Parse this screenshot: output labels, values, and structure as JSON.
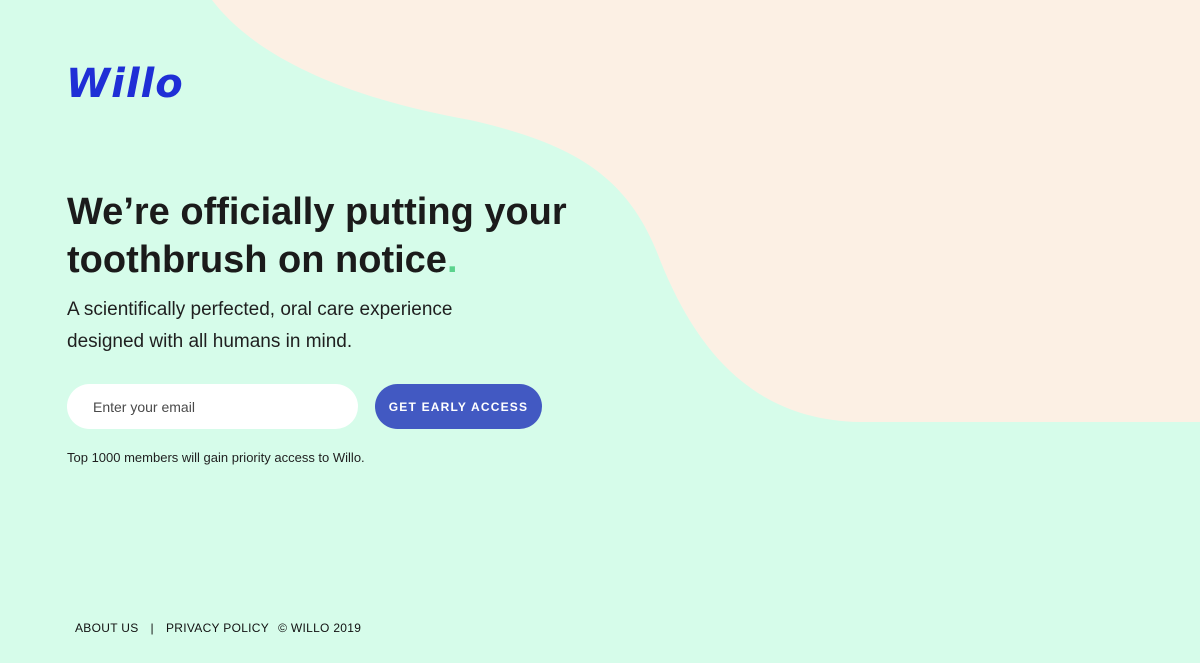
{
  "brand": {
    "logo_text": "Willo"
  },
  "hero": {
    "headline": "We’re officially putting your toothbrush on notice",
    "headline_dot": ".",
    "subhead": "A scientifically perfected, oral care experience designed with all humans in mind."
  },
  "signup": {
    "email_placeholder": "Enter your email",
    "email_value": "",
    "button_label": "GET EARLY ACCESS",
    "note": "Top 1000 members will gain priority access to Willo."
  },
  "footer": {
    "about_label": "ABOUT US",
    "separator": "|",
    "privacy_label": "PRIVACY POLICY",
    "copyright": "© WILLO 2019"
  },
  "colors": {
    "background_mint": "#d6fcea",
    "background_cream": "#fcf0e4",
    "brand_blue": "#1f2fd6",
    "button_blue": "#4259c2",
    "accent_green": "#5bd38d"
  }
}
